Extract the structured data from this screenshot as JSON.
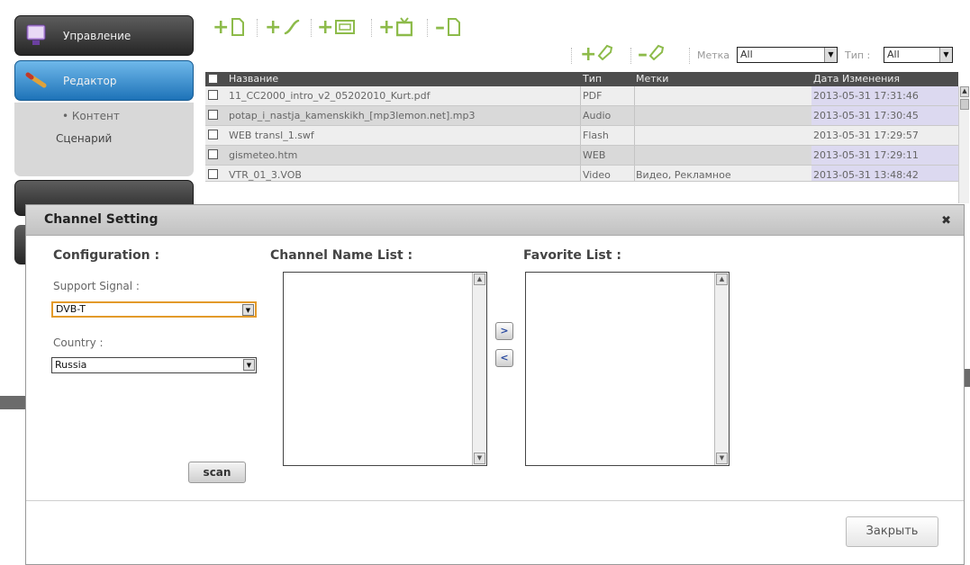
{
  "sidebar": {
    "items": [
      {
        "label": "Управление",
        "icon": "monitor-icon"
      },
      {
        "label": "Редактор",
        "icon": "pencil-icon"
      }
    ],
    "submenu": [
      "• Контент",
      "Сценарий"
    ]
  },
  "toolbar": {
    "buttons": [
      {
        "name": "add-file",
        "icon": "document-icon"
      },
      {
        "name": "add-link",
        "icon": "link-icon"
      },
      {
        "name": "add-widget",
        "icon": "widget-icon"
      },
      {
        "name": "add-tv",
        "icon": "tv-icon"
      },
      {
        "name": "remove-file",
        "icon": "document-icon"
      }
    ]
  },
  "filter": {
    "tag_label": "Метка",
    "tag_value": "All",
    "type_label": "Тип :",
    "type_value": "All"
  },
  "table": {
    "headers": {
      "name": "Название",
      "type": "Тип",
      "tags": "Метки",
      "date": "Дата Изменения"
    },
    "rows": [
      {
        "name": "11_CC2000_intro_v2_05202010_Kurt.pdf",
        "type": "PDF",
        "tags": "",
        "date": "2013-05-31 17:31:46"
      },
      {
        "name": "potap_i_nastja_kamenskikh_[mp3lemon.net].mp3",
        "type": "Audio",
        "tags": "",
        "date": "2013-05-31 17:30:45"
      },
      {
        "name": "WEB transl_1.swf",
        "type": "Flash",
        "tags": "",
        "date": "2013-05-31 17:29:57"
      },
      {
        "name": "gismeteo.htm",
        "type": "WEB",
        "tags": "",
        "date": "2013-05-31 17:29:11"
      },
      {
        "name": "VTR_01_3.VOB",
        "type": "Video",
        "tags": "Видео, Рекламное",
        "date": "2013-05-31 13:48:42"
      }
    ]
  },
  "modal": {
    "title": "Channel Setting",
    "configuration": "Configuration :",
    "support_signal_label": "Support Signal :",
    "support_signal_value": "DVB-T",
    "country_label": "Country :",
    "country_value": "Russia",
    "channel_list_title": "Channel Name List :",
    "favorite_list_title": "Favorite List :",
    "move_right": ">",
    "move_left": "<",
    "scan_label": "scan",
    "close_label": "Закрыть"
  },
  "colors": {
    "accent_green": "#8dbb4a",
    "active_nav": "#3a8fd3",
    "focus_orange": "#e39a2a"
  }
}
